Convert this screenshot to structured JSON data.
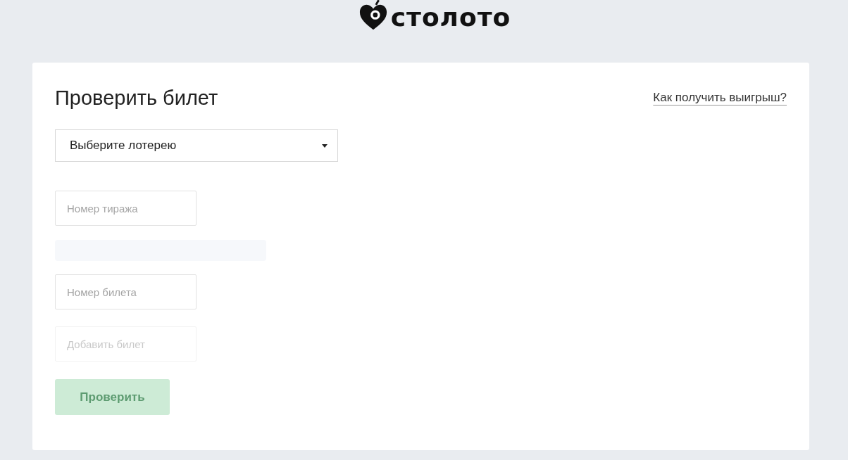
{
  "logo": {
    "text": "столото"
  },
  "card": {
    "title": "Проверить билет",
    "help_link": "Как получить выигрыш?",
    "lottery_select": {
      "value": "Выберите лотерею"
    },
    "fields": [
      {
        "kind": "input",
        "placeholder": "Номер тиража",
        "disabled": false
      },
      {
        "kind": "skeleton"
      },
      {
        "kind": "input",
        "placeholder": "Номер билета",
        "disabled": false
      },
      {
        "kind": "input",
        "placeholder": "Добавить билет",
        "disabled": true
      }
    ],
    "submit": {
      "label": "Проверить",
      "disabled": true
    }
  }
}
